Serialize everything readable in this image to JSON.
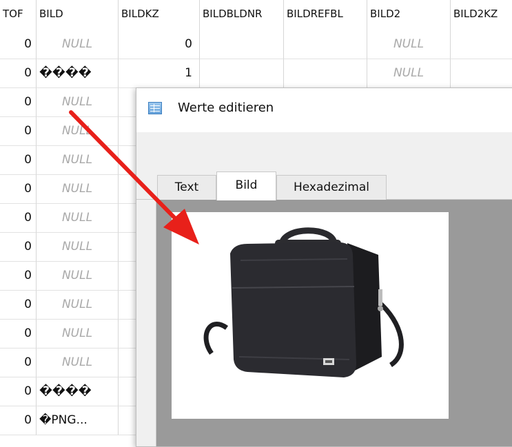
{
  "columns": [
    "TOF",
    "BILD",
    "BILDKZ",
    "BILDBLDNR",
    "BILDREFBL",
    "BILD2",
    "BILD2KZ"
  ],
  "rows": [
    {
      "tof": "0",
      "bild": "NULL",
      "bildkz": "0",
      "bild2": "NULL"
    },
    {
      "tof": "0",
      "bild": "����",
      "bildkz": "1",
      "bild2": "NULL"
    },
    {
      "tof": "0",
      "bild": "NULL"
    },
    {
      "tof": "0",
      "bild": "NULL"
    },
    {
      "tof": "0",
      "bild": "NULL"
    },
    {
      "tof": "0",
      "bild": "NULL"
    },
    {
      "tof": "0",
      "bild": "NULL"
    },
    {
      "tof": "0",
      "bild": "NULL"
    },
    {
      "tof": "0",
      "bild": "NULL"
    },
    {
      "tof": "0",
      "bild": "NULL"
    },
    {
      "tof": "0",
      "bild": "NULL"
    },
    {
      "tof": "0",
      "bild": "NULL"
    },
    {
      "tof": "0",
      "bild": "����"
    },
    {
      "tof": "0",
      "bild": "�PNG..."
    }
  ],
  "dialog": {
    "title": "Werte editieren",
    "icon": "table-icon",
    "tabs": [
      {
        "label": "Text",
        "active": false
      },
      {
        "label": "Bild",
        "active": true
      },
      {
        "label": "Hexadezimal",
        "active": false
      }
    ],
    "image_subject": "black-laptop-bag"
  },
  "colors": {
    "arrow": "#e8201a",
    "null_text": "#a9a9a9",
    "panel_bg": "#9a9a9a"
  }
}
